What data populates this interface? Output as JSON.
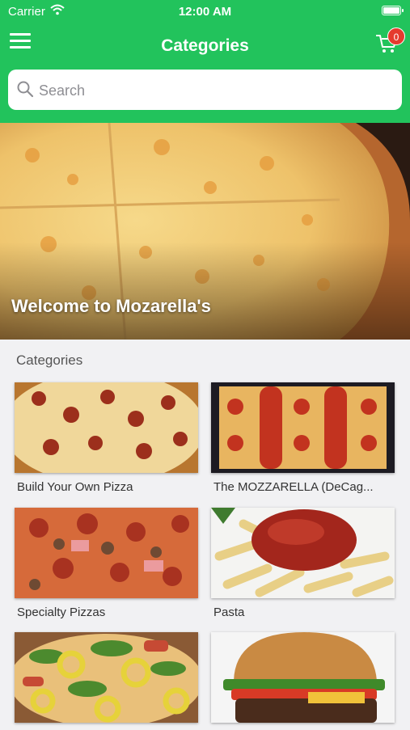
{
  "status_bar": {
    "carrier": "Carrier",
    "time": "12:00 AM"
  },
  "nav": {
    "title": "Categories",
    "cart_count": "0",
    "menu_icon": "hamburger-menu-icon",
    "cart_icon": "shopping-cart-icon"
  },
  "search": {
    "placeholder": "Search"
  },
  "hero": {
    "caption": "Welcome to Mozarella's"
  },
  "section": {
    "title": "Categories"
  },
  "categories": [
    {
      "label": "Build Your Own Pizza"
    },
    {
      "label": "The MOZZARELLA  (DeCag..."
    },
    {
      "label": "Specialty Pizzas"
    },
    {
      "label": "Pasta"
    },
    {
      "label": ""
    },
    {
      "label": ""
    }
  ],
  "colors": {
    "brand_green": "#22c35c",
    "badge_red": "#e53b2e"
  }
}
